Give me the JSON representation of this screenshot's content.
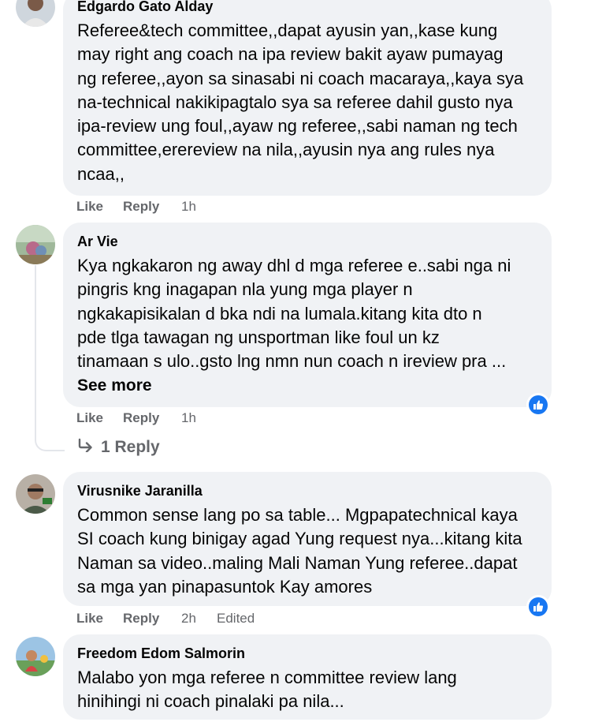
{
  "comments": [
    {
      "author": "Edgardo Gato Alday",
      "text": "Referee&tech committee,,dapat ayusin yan,,kase kung\nmay right ang coach na ipa review bakit ayaw pumayag\nng referee,,ayon sa sinasabi ni coach macaraya,,kaya sya\nna-technical nakikipagtalo sya sa referee dahil gusto nya\nipa-review ung foul,,ayaw ng referee,,sabi naman ng tech\ncommittee,erereview na nila,,ayusin nya ang rules nya\nncaa,,",
      "like": "Like",
      "reply": "Reply",
      "time": "1h"
    },
    {
      "author": "Ar Vie",
      "text": "Kya ngkakaron ng away dhl d mga referee e..sabi nga ni\npingris kng inagapan nla yung mga player n\nngkakapisikalan d bka ndi na lumala.kitang kita dto n\npde tlga tawagan ng unsportman like foul un kz\ntinamaan s ulo..gsto lng nmn nun coach n ireview pra ...",
      "see_more": "See more",
      "like": "Like",
      "reply": "Reply",
      "time": "1h",
      "replies_link": "1 Reply"
    },
    {
      "author": "Virusnike Jaranilla",
      "text": "Common sense lang po sa table... Mgpapatechnical kaya\nSI coach kung binigay agad Yung request nya...kitang kita\nNaman sa video..maling Mali Naman Yung referee..dapat\nsa mga yan pinapasuntok Kay amores",
      "like": "Like",
      "reply": "Reply",
      "time": "2h",
      "edited": "Edited"
    },
    {
      "author": "Freedom Edom Salmorin",
      "text": "Malabo yon mga referee n committee review lang\nhinihingi ni coach pinalaki pa nila..."
    }
  ],
  "icons": {
    "reaction": "like-thumb-icon",
    "reply_arrow": "reply-arrow-icon"
  },
  "colors": {
    "bubble": "#f0f2f5",
    "meta_text": "#65676b",
    "like_blue": "#1877f2"
  }
}
